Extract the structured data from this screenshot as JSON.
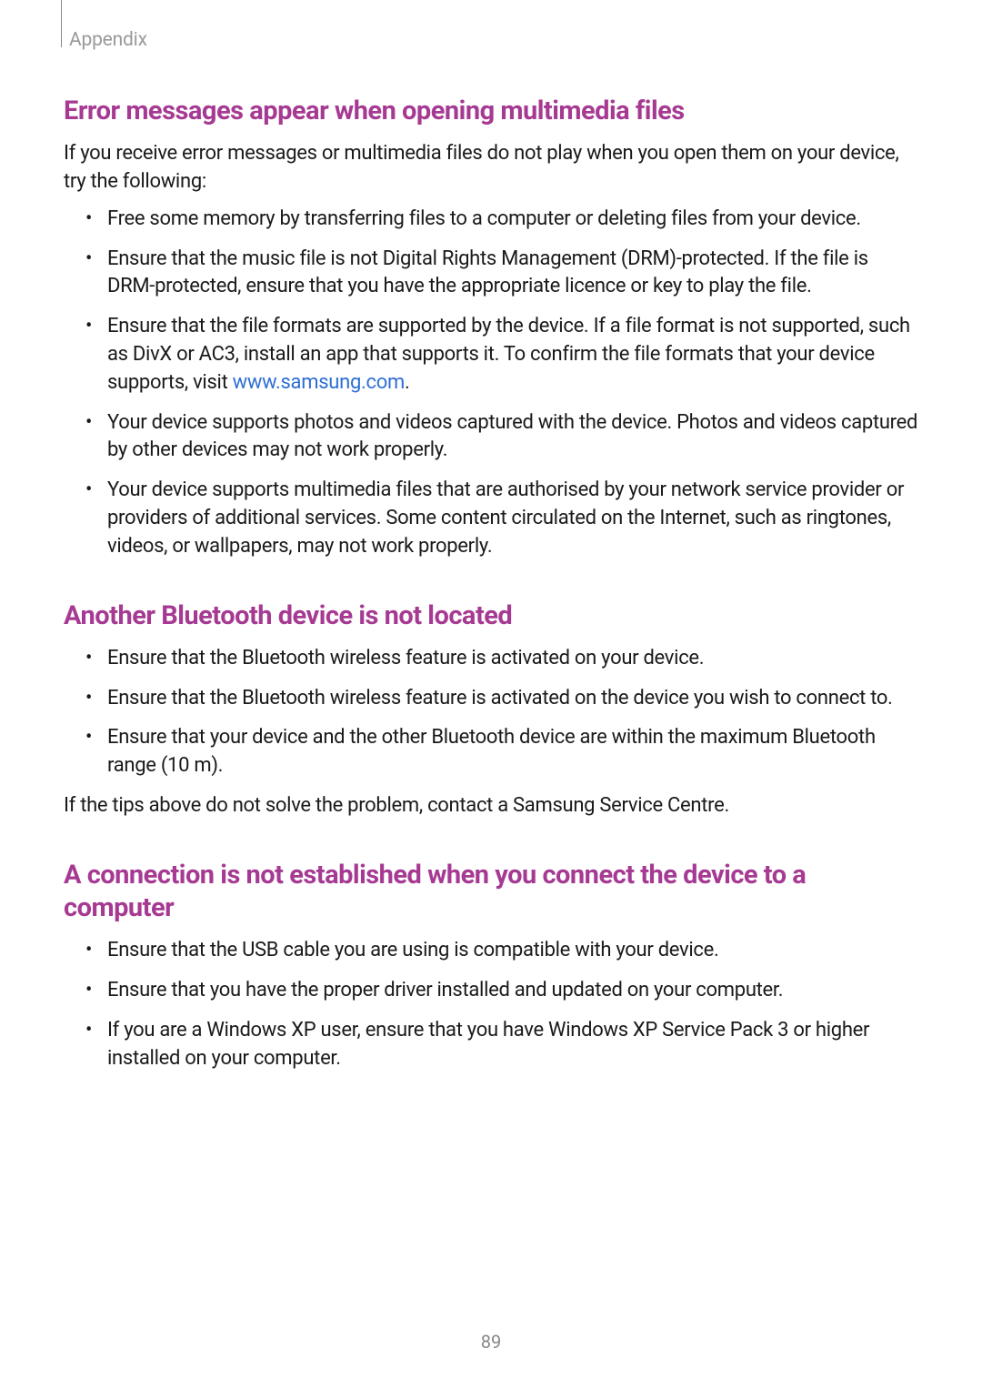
{
  "header": {
    "label": "Appendix"
  },
  "sections": [
    {
      "heading": "Error messages appear when opening multimedia files",
      "intro": "If you receive error messages or multimedia files do not play when you open them on your device, try the following:",
      "bullets": [
        {
          "text": "Free some memory by transferring files to a computer or deleting files from your device."
        },
        {
          "text": "Ensure that the music file is not Digital Rights Management (DRM)-protected. If the file is DRM-protected, ensure that you have the appropriate licence or key to play the file."
        },
        {
          "pre": "Ensure that the file formats are supported by the device. If a file format is not supported, such as DivX or AC3, install an app that supports it. To confirm the file formats that your device supports, visit ",
          "link": "www.samsung.com",
          "post": "."
        },
        {
          "text": "Your device supports photos and videos captured with the device. Photos and videos captured by other devices may not work properly."
        },
        {
          "text": "Your device supports multimedia files that are authorised by your network service provider or providers of additional services. Some content circulated on the Internet, such as ringtones, videos, or wallpapers, may not work properly."
        }
      ]
    },
    {
      "heading": "Another Bluetooth device is not located",
      "bullets": [
        {
          "text": "Ensure that the Bluetooth wireless feature is activated on your device."
        },
        {
          "text": "Ensure that the Bluetooth wireless feature is activated on the device you wish to connect to."
        },
        {
          "text": "Ensure that your device and the other Bluetooth device are within the maximum Bluetooth range (10 m)."
        }
      ],
      "outro": "If the tips above do not solve the problem, contact a Samsung Service Centre."
    },
    {
      "heading": "A connection is not established when you connect the device to a computer",
      "bullets": [
        {
          "text": "Ensure that the USB cable you are using is compatible with your device."
        },
        {
          "text": "Ensure that you have the proper driver installed and updated on your computer."
        },
        {
          "text": "If you are a Windows XP user, ensure that you have Windows XP Service Pack 3 or higher installed on your computer."
        }
      ]
    }
  ],
  "page_number": "89"
}
